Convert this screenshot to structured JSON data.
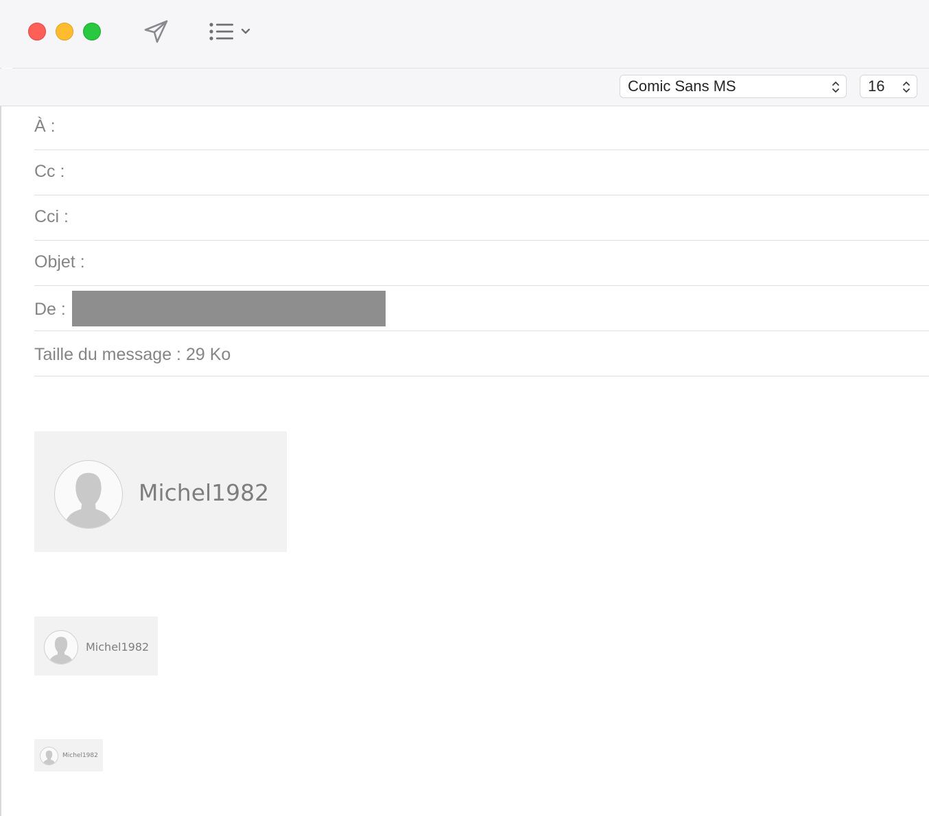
{
  "window": {
    "buttons": {
      "close": "close",
      "minimize": "minimize",
      "zoom": "zoom"
    },
    "toolbar": {
      "send_icon": "paper-plane-send-icon",
      "list_icon": "bulleted-list-icon"
    }
  },
  "formatbar": {
    "font_family": "Comic Sans MS",
    "font_size": "16"
  },
  "header": {
    "to_label": "À :",
    "cc_label": "Cc :",
    "bcc_label": "Cci :",
    "subject_label": "Objet :",
    "from_label": "De :",
    "size_label": "Taille du message : 29 Ko"
  },
  "body": {
    "signatures": [
      {
        "name": "Michel1982"
      },
      {
        "name": "Michel1982"
      },
      {
        "name": "Michel1982"
      }
    ]
  },
  "colors": {
    "close": "#fe5f57",
    "minimize": "#febc2e",
    "zoom": "#28c840",
    "redacted": "#8e8e8e",
    "label": "#858585"
  }
}
